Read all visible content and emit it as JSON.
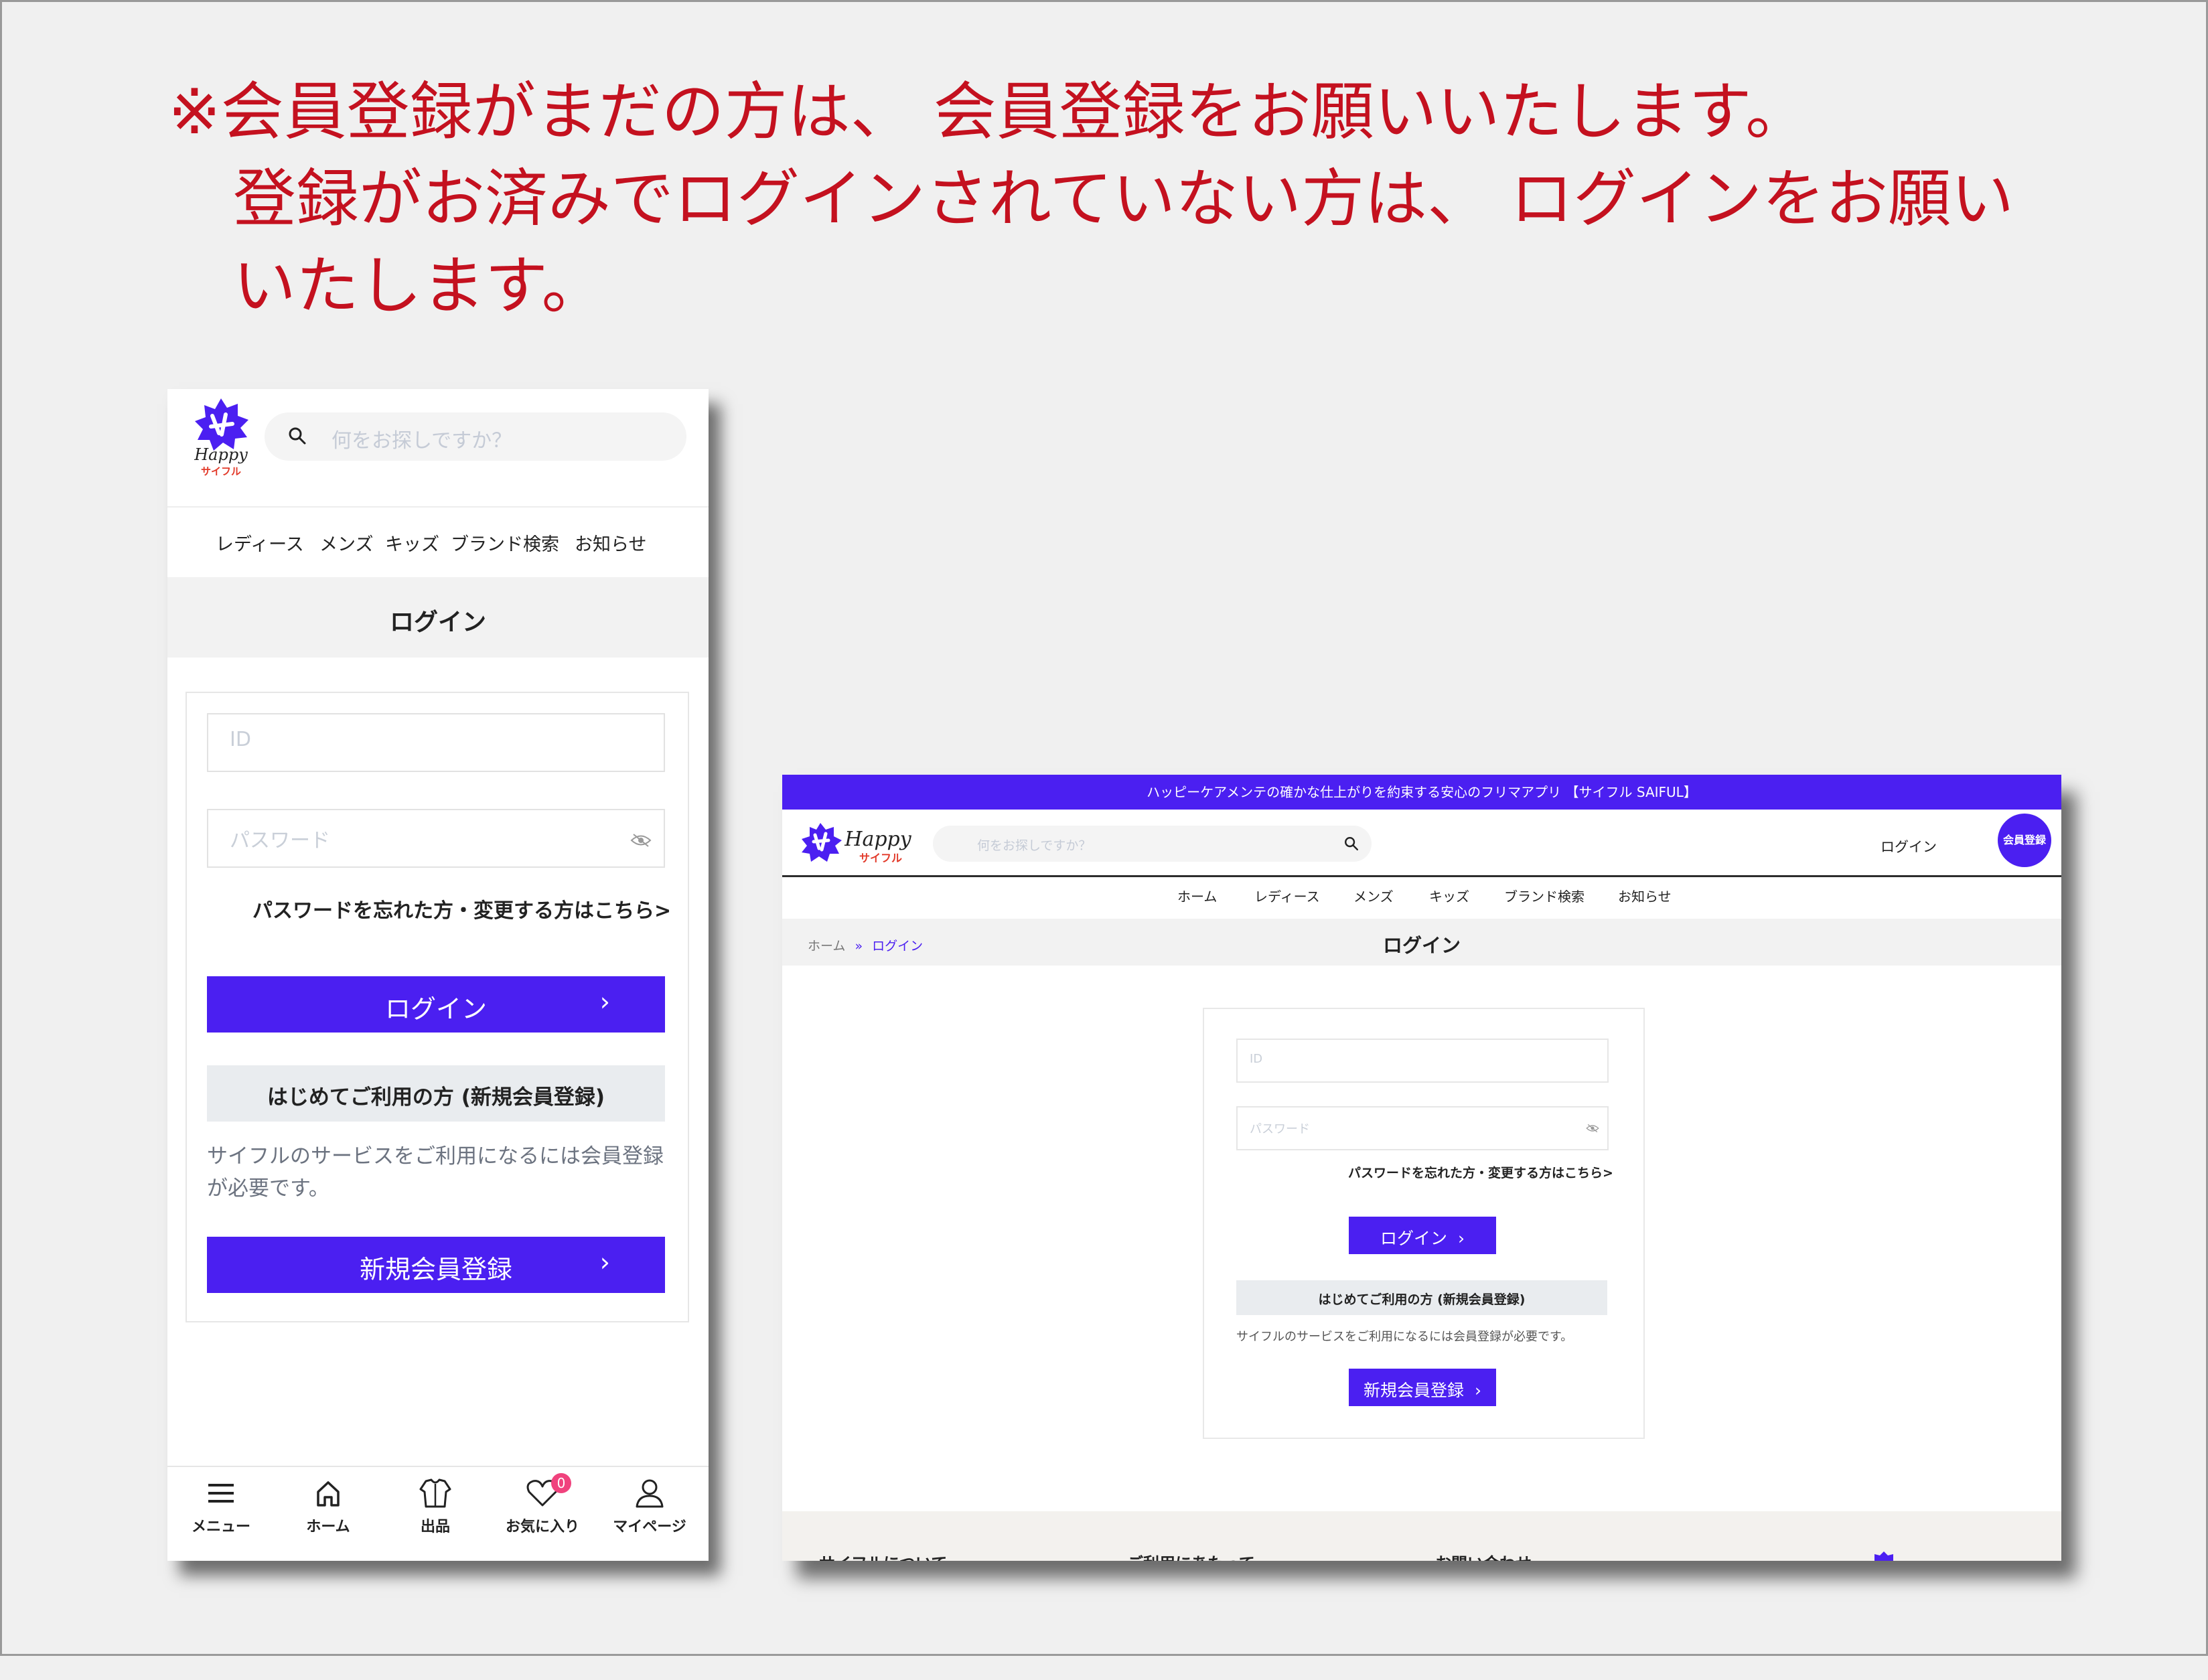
{
  "notice": {
    "line1": "※会員登録がまだの方は、 会員登録をお願いいたします。",
    "line2": "登録がお済みでログインされていない方は、 ログインをお願い",
    "line3": "いたします。"
  },
  "mobile": {
    "logo_text": "Happy",
    "logo_sub": "サイフル",
    "search_placeholder": "何をお探しですか？",
    "nav": [
      "レディース",
      "メンズ",
      "キッズ",
      "ブランド検索",
      "お知らせ"
    ],
    "page_title": "ログイン",
    "id_placeholder": "ID",
    "password_placeholder": "パスワード",
    "forgot_link": "パスワードを忘れた方・変更する方はこちら>",
    "login_button": "ログイン",
    "first_time_heading": "はじめてご利用の方 (新規会員登録)",
    "first_time_desc": "サイフルのサービスをご利用になるには会員登録が必要です。",
    "register_button": "新規会員登録",
    "tabbar": [
      {
        "label": "メニュー",
        "icon": "menu-icon"
      },
      {
        "label": "ホーム",
        "icon": "home-icon"
      },
      {
        "label": "出品",
        "icon": "shirt-icon"
      },
      {
        "label": "お気に入り",
        "icon": "heart-icon"
      },
      {
        "label": "マイページ",
        "icon": "user-icon"
      }
    ],
    "favorites_badge": "0"
  },
  "desktop": {
    "top_banner": "ハッピーケアメンテの確かな仕上がりを約束する安心のフリマアプリ 【サイフル SAIFUL】",
    "logo_text": "Happy",
    "logo_sub": "サイフル",
    "search_placeholder": "何をお探しですか？",
    "login_link": "ログイン",
    "register_badge": "会員登録",
    "nav": [
      "ホーム",
      "レディース",
      "メンズ",
      "キッズ",
      "ブランド検索",
      "お知らせ"
    ],
    "breadcrumb": {
      "home": "ホーム",
      "sep": "»",
      "current": "ログイン"
    },
    "page_title": "ログイン",
    "id_placeholder": "ID",
    "password_placeholder": "パスワード",
    "forgot_link": "パスワードを忘れた方・変更する方はこちら>",
    "login_button": "ログイン",
    "first_time_heading": "はじめてご利用の方 (新規会員登録)",
    "first_time_desc": "サイフルのサービスをご利用になるには会員登録が必要です。",
    "register_button": "新規会員登録",
    "footer": [
      "サイフルについて",
      "ご利用にあたって",
      "お問い合わせ"
    ]
  },
  "colors": {
    "accent": "#4b1ff1",
    "notice": "#c4111f",
    "badge": "#f0427d"
  }
}
